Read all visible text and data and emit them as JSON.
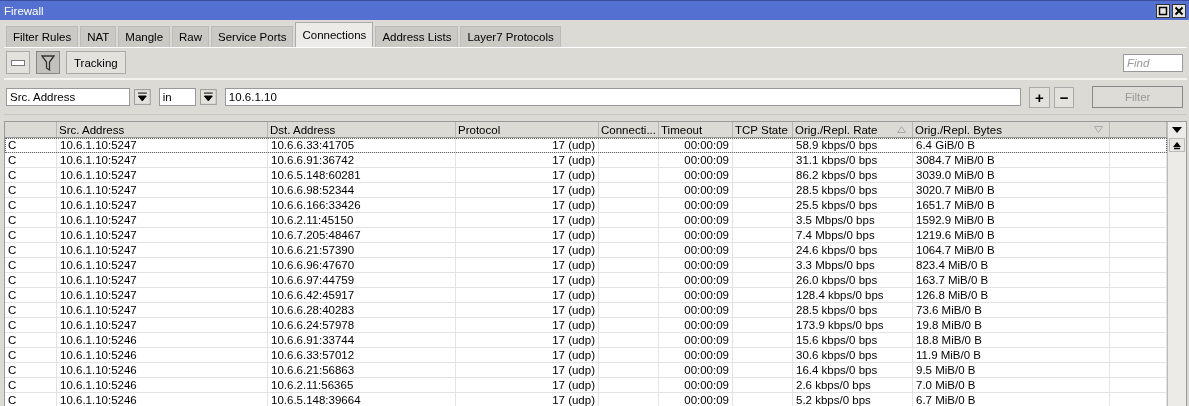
{
  "window": {
    "title": "Firewall"
  },
  "tabs": [
    {
      "label": "Filter Rules",
      "selected": false
    },
    {
      "label": "NAT",
      "selected": false
    },
    {
      "label": "Mangle",
      "selected": false
    },
    {
      "label": "Raw",
      "selected": false
    },
    {
      "label": "Service Ports",
      "selected": false
    },
    {
      "label": "Connections",
      "selected": true
    },
    {
      "label": "Address Lists",
      "selected": false
    },
    {
      "label": "Layer7 Protocols",
      "selected": false
    }
  ],
  "toolbar": {
    "buttons": [
      {
        "kind": "minus",
        "pressed": false
      },
      {
        "kind": "filter",
        "pressed": true
      },
      {
        "kind": "text",
        "label": "Tracking",
        "pressed": false
      }
    ],
    "find_placeholder": "Find"
  },
  "filter": {
    "field": "Src. Address",
    "operator": "in",
    "value": "10.6.1.10",
    "add_label": "+",
    "remove_label": "−",
    "apply_button": {
      "label": "Filter",
      "disabled": true
    }
  },
  "table": {
    "columns": [
      {
        "label": "Src. Address",
        "sorted": false
      },
      {
        "label": "Dst. Address",
        "sorted": false
      },
      {
        "label": "Protocol",
        "sorted": false
      },
      {
        "label": "Connecti...",
        "sorted": false
      },
      {
        "label": "Timeout",
        "sorted": false
      },
      {
        "label": "TCP State",
        "sorted": false
      },
      {
        "label": "Orig./Repl. Rate",
        "sorted": true,
        "descending": false
      },
      {
        "label": "Orig./Repl. Bytes",
        "sorted": true,
        "descending": true
      }
    ],
    "rows": [
      {
        "flag": "C",
        "src": "10.6.1.10:5247",
        "dst": "10.6.6.33:41705",
        "protocol": "17 (udp)",
        "timeout": "00:00:09",
        "rate": "58.9 kbps/0 bps",
        "bytes": "6.4 GiB/0 B",
        "selected": true
      },
      {
        "flag": "C",
        "src": "10.6.1.10:5247",
        "dst": "10.6.6.91:36742",
        "protocol": "17 (udp)",
        "timeout": "00:00:09",
        "rate": "31.1 kbps/0 bps",
        "bytes": "3084.7 MiB/0 B",
        "selected": false
      },
      {
        "flag": "C",
        "src": "10.6.1.10:5247",
        "dst": "10.6.5.148:60281",
        "protocol": "17 (udp)",
        "timeout": "00:00:09",
        "rate": "86.2 kbps/0 bps",
        "bytes": "3039.0 MiB/0 B",
        "selected": false
      },
      {
        "flag": "C",
        "src": "10.6.1.10:5247",
        "dst": "10.6.6.98:52344",
        "protocol": "17 (udp)",
        "timeout": "00:00:09",
        "rate": "28.5 kbps/0 bps",
        "bytes": "3020.7 MiB/0 B",
        "selected": false
      },
      {
        "flag": "C",
        "src": "10.6.1.10:5247",
        "dst": "10.6.6.166:33426",
        "protocol": "17 (udp)",
        "timeout": "00:00:09",
        "rate": "25.5 kbps/0 bps",
        "bytes": "1651.7 MiB/0 B",
        "selected": false
      },
      {
        "flag": "C",
        "src": "10.6.1.10:5247",
        "dst": "10.6.2.11:45150",
        "protocol": "17 (udp)",
        "timeout": "00:00:09",
        "rate": "3.5 Mbps/0 bps",
        "bytes": "1592.9 MiB/0 B",
        "selected": false
      },
      {
        "flag": "C",
        "src": "10.6.1.10:5247",
        "dst": "10.6.7.205:48467",
        "protocol": "17 (udp)",
        "timeout": "00:00:09",
        "rate": "7.4 Mbps/0 bps",
        "bytes": "1219.6 MiB/0 B",
        "selected": false
      },
      {
        "flag": "C",
        "src": "10.6.1.10:5247",
        "dst": "10.6.6.21:57390",
        "protocol": "17 (udp)",
        "timeout": "00:00:09",
        "rate": "24.6 kbps/0 bps",
        "bytes": "1064.7 MiB/0 B",
        "selected": false
      },
      {
        "flag": "C",
        "src": "10.6.1.10:5247",
        "dst": "10.6.6.96:47670",
        "protocol": "17 (udp)",
        "timeout": "00:00:09",
        "rate": "3.3 Mbps/0 bps",
        "bytes": "823.4 MiB/0 B",
        "selected": false
      },
      {
        "flag": "C",
        "src": "10.6.1.10:5247",
        "dst": "10.6.6.97:44759",
        "protocol": "17 (udp)",
        "timeout": "00:00:09",
        "rate": "26.0 kbps/0 bps",
        "bytes": "163.7 MiB/0 B",
        "selected": false
      },
      {
        "flag": "C",
        "src": "10.6.1.10:5247",
        "dst": "10.6.6.42:45917",
        "protocol": "17 (udp)",
        "timeout": "00:00:09",
        "rate": "128.4 kbps/0 bps",
        "bytes": "126.8 MiB/0 B",
        "selected": false
      },
      {
        "flag": "C",
        "src": "10.6.1.10:5247",
        "dst": "10.6.6.28:40283",
        "protocol": "17 (udp)",
        "timeout": "00:00:09",
        "rate": "28.5 kbps/0 bps",
        "bytes": "73.6 MiB/0 B",
        "selected": false
      },
      {
        "flag": "C",
        "src": "10.6.1.10:5247",
        "dst": "10.6.6.24:57978",
        "protocol": "17 (udp)",
        "timeout": "00:00:09",
        "rate": "173.9 kbps/0 bps",
        "bytes": "19.8 MiB/0 B",
        "selected": false
      },
      {
        "flag": "C",
        "src": "10.6.1.10:5246",
        "dst": "10.6.6.91:33744",
        "protocol": "17 (udp)",
        "timeout": "00:00:09",
        "rate": "15.6 kbps/0 bps",
        "bytes": "18.8 MiB/0 B",
        "selected": false
      },
      {
        "flag": "C",
        "src": "10.6.1.10:5246",
        "dst": "10.6.6.33:57012",
        "protocol": "17 (udp)",
        "timeout": "00:00:09",
        "rate": "30.6 kbps/0 bps",
        "bytes": "11.9 MiB/0 B",
        "selected": false
      },
      {
        "flag": "C",
        "src": "10.6.1.10:5246",
        "dst": "10.6.6.21:56863",
        "protocol": "17 (udp)",
        "timeout": "00:00:09",
        "rate": "16.4 kbps/0 bps",
        "bytes": "9.5 MiB/0 B",
        "selected": false
      },
      {
        "flag": "C",
        "src": "10.6.1.10:5246",
        "dst": "10.6.2.11:56365",
        "protocol": "17 (udp)",
        "timeout": "00:00:09",
        "rate": "2.6 kbps/0 bps",
        "bytes": "7.0 MiB/0 B",
        "selected": false
      },
      {
        "flag": "C",
        "src": "10.6.1.10:5246",
        "dst": "10.6.5.148:39664",
        "protocol": "17 (udp)",
        "timeout": "00:00:09",
        "rate": "5.2 kbps/0 bps",
        "bytes": "6.7 MiB/0 B",
        "selected": false
      }
    ]
  }
}
